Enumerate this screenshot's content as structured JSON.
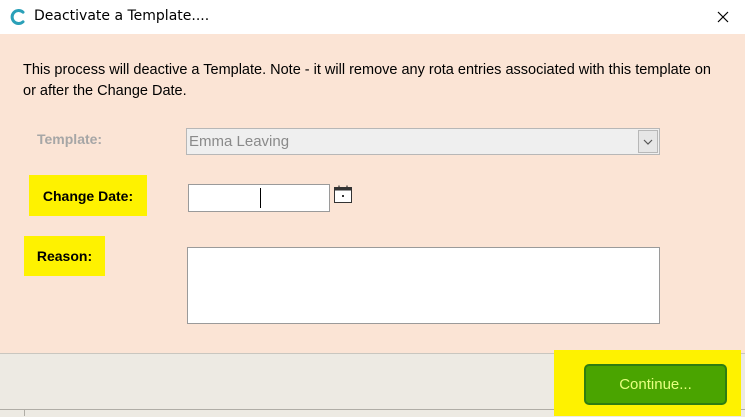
{
  "window": {
    "title": "Deactivate a Template....",
    "app_icon": "app-c-icon",
    "close_icon": "close-icon"
  },
  "description": "This process will deactive a Template.  Note - it will remove any rota entries associated with this template on or after the Change Date.",
  "form": {
    "template_label": "Template:",
    "template_value": "Emma Leaving",
    "change_date_label": "Change Date:",
    "change_date_value": "",
    "reason_label": "Reason:",
    "reason_value": ""
  },
  "footer": {
    "continue_label": "Continue..."
  },
  "colors": {
    "background": "#fbe4d5",
    "highlight": "#fef200",
    "button_green": "#4aa400",
    "button_text": "#e6ff80",
    "footer": "#edeae3"
  }
}
